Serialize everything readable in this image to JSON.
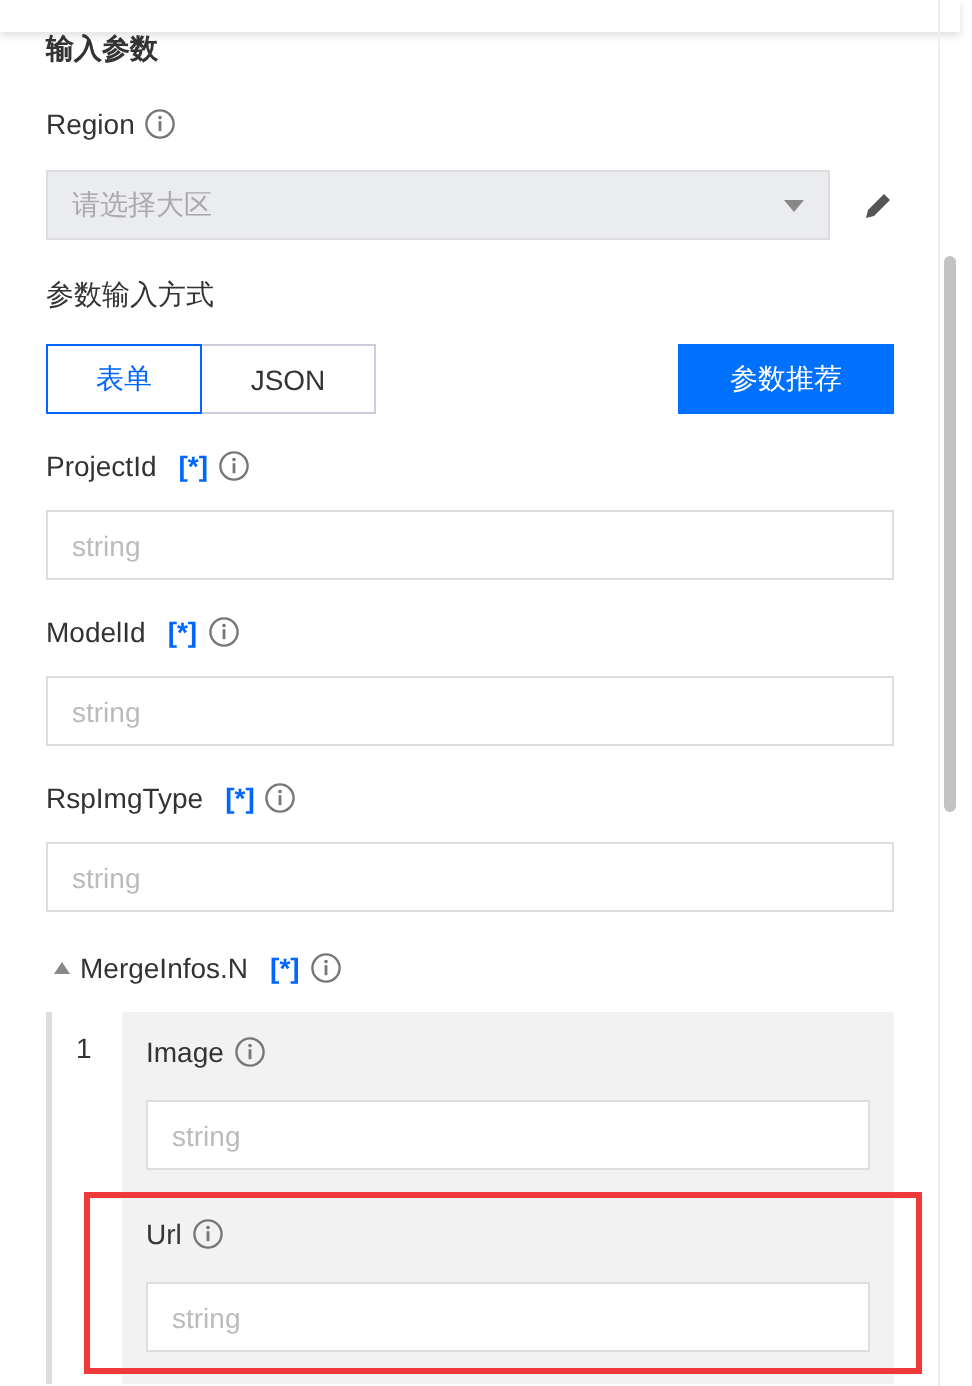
{
  "section_title": "输入参数",
  "region": {
    "label": "Region",
    "placeholder": "请选择大区",
    "disabled": true
  },
  "input_mode": {
    "label": "参数输入方式",
    "options": [
      {
        "label": "表单",
        "selected": true
      },
      {
        "label": "JSON",
        "selected": false
      }
    ],
    "recommend_button": "参数推荐"
  },
  "fields": [
    {
      "label": "ProjectId",
      "required_mark": "[*]",
      "placeholder": "string"
    },
    {
      "label": "ModelId",
      "required_mark": "[*]",
      "placeholder": "string"
    },
    {
      "label": "RspImgType",
      "required_mark": "[*]",
      "placeholder": "string"
    }
  ],
  "merge_infos": {
    "label": "MergeInfos.N",
    "required_mark": "[*]",
    "expanded": true,
    "items": [
      {
        "index": "1",
        "fields": [
          {
            "label": "Image",
            "placeholder": "string",
            "highlighted": false
          },
          {
            "label": "Url",
            "placeholder": "string",
            "highlighted": true
          }
        ]
      }
    ]
  }
}
